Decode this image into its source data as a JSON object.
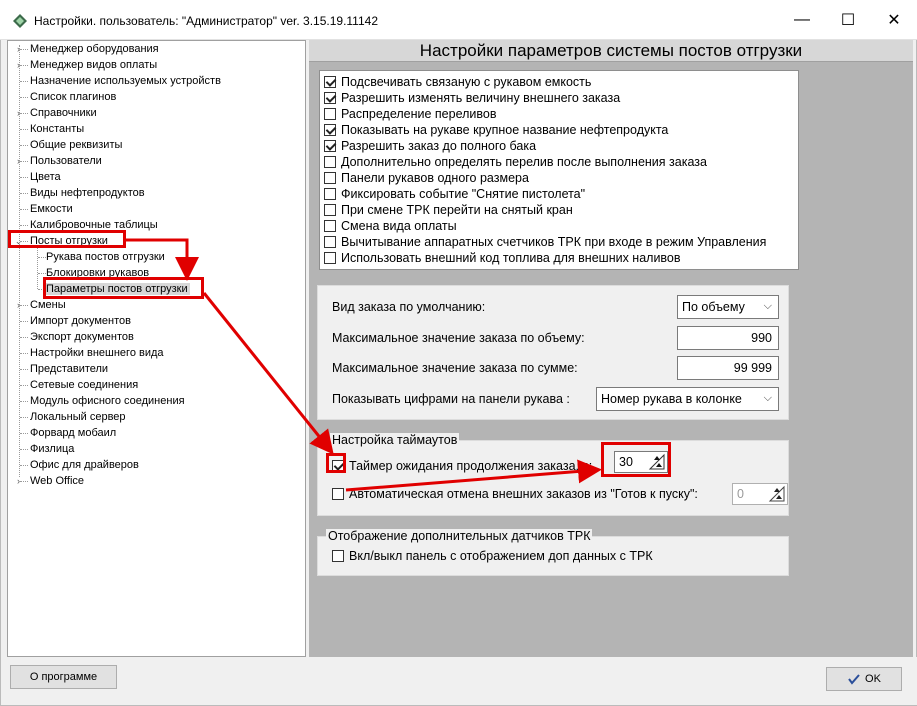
{
  "window": {
    "title": "Настройки. пользователь: \"Администратор\" ver. 3.15.19.11142",
    "minimize_glyph": "—",
    "maximize_glyph": "☐",
    "close_glyph": "✕"
  },
  "tree": {
    "items": [
      {
        "label": "Менеджер оборудования",
        "expander": "›"
      },
      {
        "label": "Менеджер видов оплаты",
        "expander": "›"
      },
      {
        "label": "Назначение используемых устройств",
        "expander": ""
      },
      {
        "label": "Список плагинов",
        "expander": ""
      },
      {
        "label": "Справочники",
        "expander": "›"
      },
      {
        "label": "Константы",
        "expander": ""
      },
      {
        "label": "Общие реквизиты",
        "expander": ""
      },
      {
        "label": "Пользователи",
        "expander": "›"
      },
      {
        "label": "Цвета",
        "expander": ""
      },
      {
        "label": "Виды нефтепродуктов",
        "expander": ""
      },
      {
        "label": "Емкости",
        "expander": ""
      },
      {
        "label": "Калибровочные таблицы",
        "expander": ""
      },
      {
        "label": "Посты отгрузки",
        "expander": "⌄"
      },
      {
        "label": "Рукава постов отгрузки",
        "expander": ""
      },
      {
        "label": "Блокировки рукавов",
        "expander": ""
      },
      {
        "label": "Параметры постов отгрузки",
        "expander": ""
      },
      {
        "label": "Смены",
        "expander": "›"
      },
      {
        "label": "Импорт документов",
        "expander": ""
      },
      {
        "label": "Экспорт документов",
        "expander": ""
      },
      {
        "label": "Настройки внешнего вида",
        "expander": ""
      },
      {
        "label": "Представители",
        "expander": ""
      },
      {
        "label": "Сетевые соединения",
        "expander": ""
      },
      {
        "label": "Модуль офисного соединения",
        "expander": ""
      },
      {
        "label": "Локальный сервер",
        "expander": ""
      },
      {
        "label": "Форвард мобаил",
        "expander": ""
      },
      {
        "label": "Физлица",
        "expander": ""
      },
      {
        "label": "Офис для драйверов",
        "expander": ""
      },
      {
        "label": "Web Office",
        "expander": "›"
      }
    ]
  },
  "panel": {
    "title": "Настройки параметров системы постов отгрузки",
    "checkboxes": [
      {
        "label": "Подсвечивать связаную с рукавом емкость",
        "checked": true
      },
      {
        "label": "Разрешить изменять величину внешнего заказа",
        "checked": true
      },
      {
        "label": "Распределение переливов",
        "checked": false
      },
      {
        "label": "Показывать на рукаве крупное название нефтепродукта",
        "checked": true
      },
      {
        "label": "Разрешить заказ до полного бака",
        "checked": true
      },
      {
        "label": "Дополнительно определять перелив после выполнения заказа",
        "checked": false
      },
      {
        "label": "Панели рукавов одного размера",
        "checked": false
      },
      {
        "label": "Фиксировать событие \"Снятие пистолета\"",
        "checked": false
      },
      {
        "label": "При смене ТРК перейти на снятый кран",
        "checked": false
      },
      {
        "label": "Смена вида оплаты",
        "checked": false
      },
      {
        "label": "Вычитывание аппаратных счетчиков ТРК при входе в режим Управления",
        "checked": false
      },
      {
        "label": "Использовать внешний код топлива для внешних наливов",
        "checked": false
      }
    ],
    "order": {
      "default_type_label": "Вид заказа по умолчанию:",
      "default_type_value": "По объему",
      "max_volume_label": "Максимальное значение заказа по объему:",
      "max_volume_value": "990",
      "max_sum_label": "Максимальное значение заказа по сумме:",
      "max_sum_value": "99 999",
      "digits_label": "Показывать цифрами на панели рукава :",
      "digits_value": "Номер рукава в колонке",
      "chevron": "⌵"
    },
    "timeouts": {
      "legend": "Настройка таймаутов",
      "timer_label": "Таймер ожидания продолжения заказа, с:",
      "timer_checked": true,
      "timer_value": "30",
      "auto_cancel_label": "Автоматическая отмена внешних заказов из \"Готов к пуску\":",
      "auto_cancel_checked": false,
      "auto_cancel_value": "0"
    },
    "sensors": {
      "legend": "Отображение дополнительных датчиков ТРК",
      "toggle_label": "Вкл/выкл панель с отображением доп данных с ТРК",
      "toggle_checked": false
    }
  },
  "buttons": {
    "about_label": "О программе",
    "ok_label": "OK"
  },
  "colors": {
    "annotation": "#e00000",
    "panel_bg": "#b4b4b4"
  }
}
